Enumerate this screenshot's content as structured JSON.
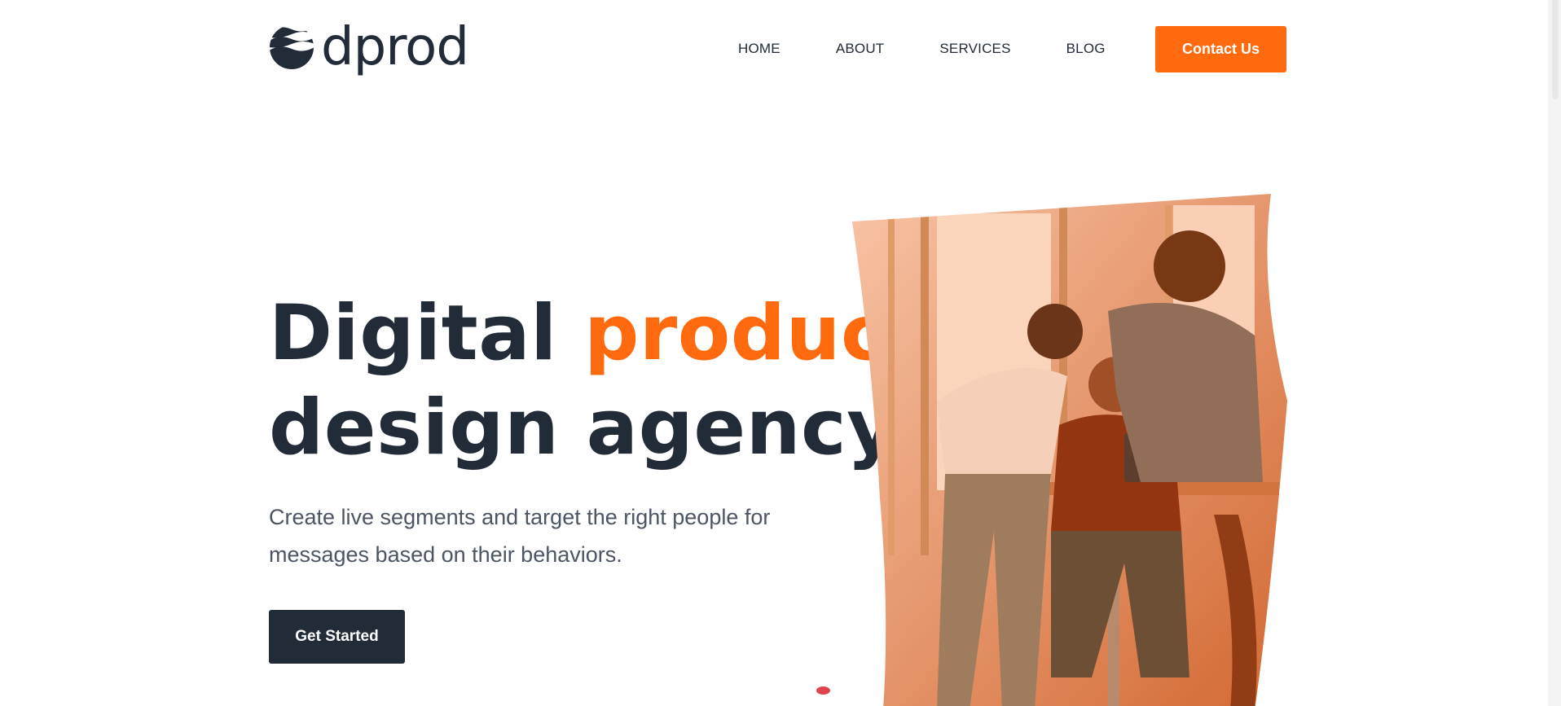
{
  "brand": {
    "name": "dprod",
    "logo_icon": "waves-circle-icon"
  },
  "nav": {
    "items": [
      {
        "label": "HOME"
      },
      {
        "label": "ABOUT"
      },
      {
        "label": "SERVICES"
      },
      {
        "label": "BLOG"
      }
    ],
    "contact_label": "Contact Us"
  },
  "hero": {
    "title_line1_start": "Digital",
    "title_line1_accent": "product",
    "title_line2": "design agency",
    "subtitle": "Create live segments and target the right people for messages based on their behaviors.",
    "cta_label": "Get Started",
    "image_icon": "team-photo-image"
  },
  "colors": {
    "accent": "#ff6a0f",
    "dark": "#222b38",
    "text": "#4b5563"
  }
}
